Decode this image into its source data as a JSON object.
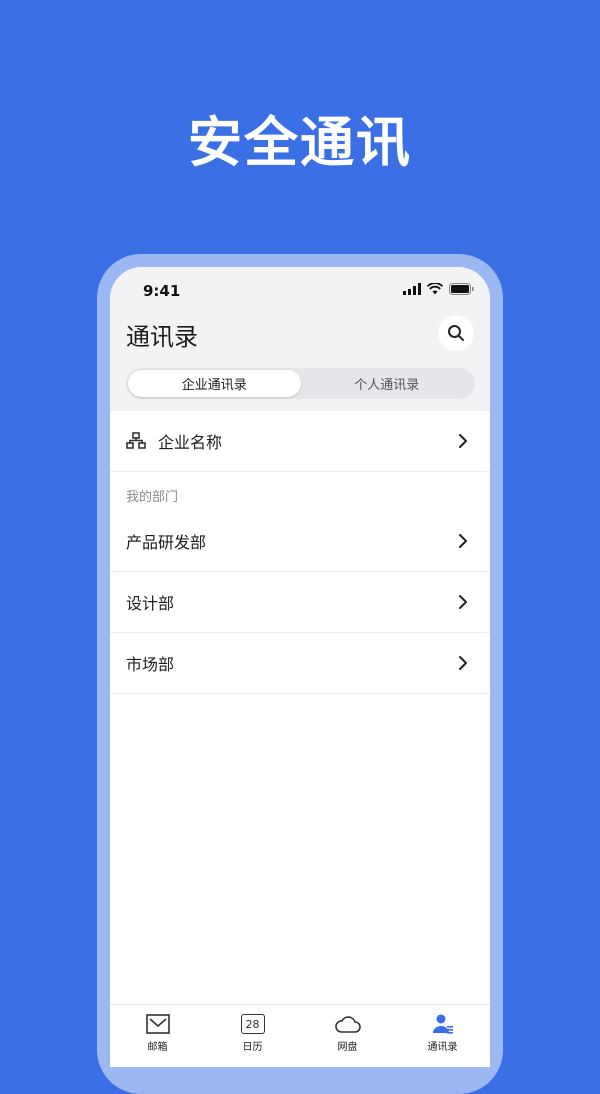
{
  "hero": {
    "title": "安全通讯"
  },
  "status_bar": {
    "time": "9:41"
  },
  "header": {
    "title": "通讯录"
  },
  "segments": [
    {
      "label": "企业通讯录",
      "active": true
    },
    {
      "label": "个人通讯录",
      "active": false
    }
  ],
  "company": {
    "label": "企业名称"
  },
  "my_departments": {
    "section_label": "我的部门",
    "items": [
      {
        "label": "产品研发部"
      },
      {
        "label": "设计部"
      },
      {
        "label": "市场部"
      }
    ]
  },
  "tab_bar": {
    "items": [
      {
        "label": "邮箱",
        "icon": "mail-icon"
      },
      {
        "label": "日历",
        "icon": "calendar-icon",
        "icon_text": "28"
      },
      {
        "label": "网盘",
        "icon": "cloud-icon"
      },
      {
        "label": "通讯录",
        "icon": "contacts-icon",
        "active": true
      }
    ]
  },
  "colors": {
    "brand_blue": "#3a6fe6",
    "active_tab": "#3a6fe6"
  }
}
